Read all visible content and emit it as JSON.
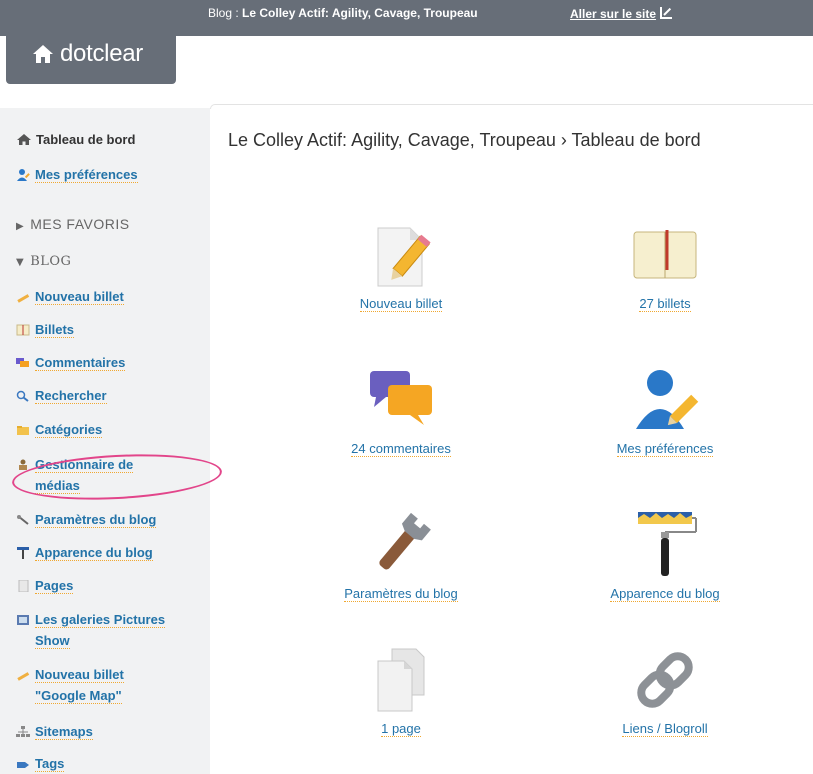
{
  "header": {
    "brand": "dotclear",
    "blog_label": "Blog : ",
    "blog_name": "Le Colley Actif: Agility, Cavage, Troupeau",
    "goto_site": "Aller sur le site"
  },
  "sidebar": {
    "dashboard": "Tableau de bord",
    "preferences": "Mes préférences",
    "favorites": "MES FAVORIS",
    "blog_section": "BLOG",
    "items": [
      {
        "label": "Nouveau billet"
      },
      {
        "label": "Billets"
      },
      {
        "label": "Commentaires"
      },
      {
        "label": "Rechercher"
      },
      {
        "label": "Catégories"
      },
      {
        "label": "Gestionnaire de"
      },
      {
        "label": "médias"
      },
      {
        "label": "Paramètres du blog"
      },
      {
        "label": "Apparence du blog"
      },
      {
        "label": "Pages"
      },
      {
        "label": "Les galeries Pictures"
      },
      {
        "label": "Show"
      },
      {
        "label": "Nouveau billet"
      },
      {
        "label": "\"Google Map\""
      },
      {
        "label": "Sitemaps"
      },
      {
        "label": "Tags"
      }
    ]
  },
  "main": {
    "breadcrumb": "Le Colley Actif: Agility, Cavage, Troupeau › Tableau de bord",
    "tiles": [
      {
        "label": "Nouveau billet"
      },
      {
        "label": "27 billets"
      },
      {
        "label": "24 commentaires"
      },
      {
        "label": "Mes préférences"
      },
      {
        "label": "Paramètres du blog"
      },
      {
        "label": "Apparence du blog"
      },
      {
        "label": "1 page"
      },
      {
        "label": "Liens / Blogroll"
      }
    ]
  },
  "colors": {
    "header_bg": "#676e78",
    "link": "#2373a8",
    "link_underline": "#f0a830",
    "highlight_ring": "#e2458a",
    "sidebar_bg": "#f1f2f3"
  }
}
